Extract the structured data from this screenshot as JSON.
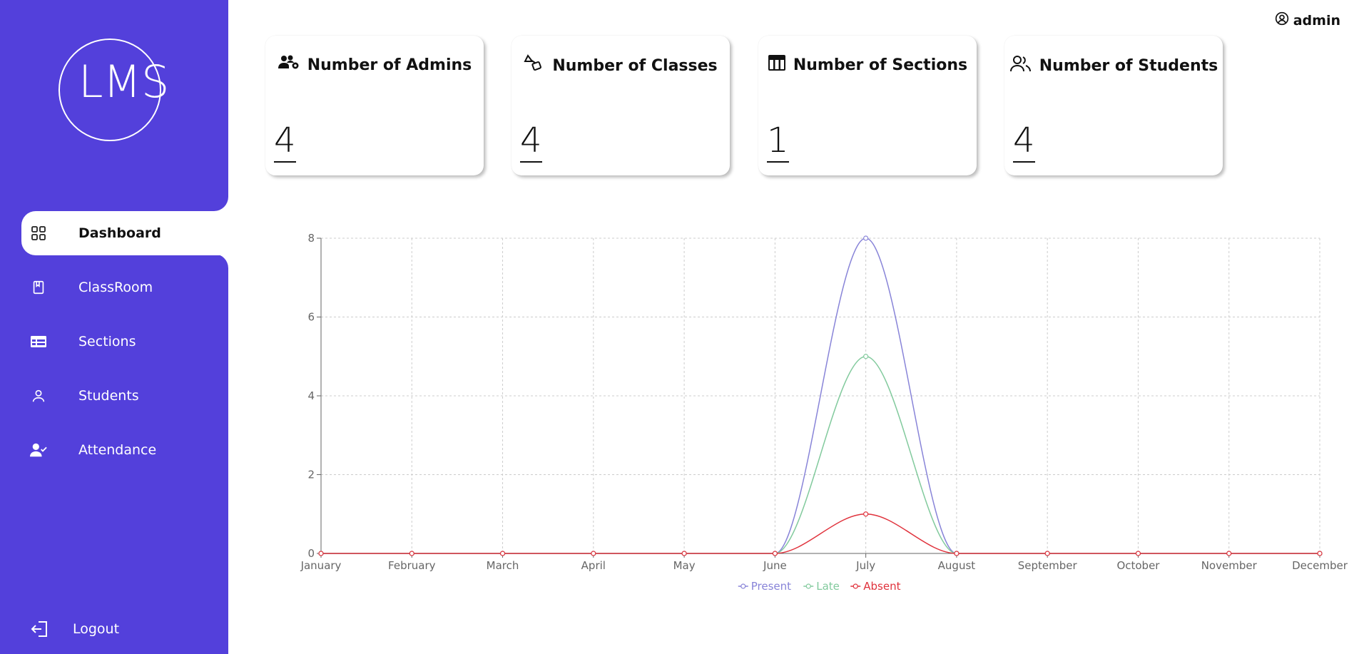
{
  "app": {
    "logo_text": "LMS"
  },
  "user": {
    "name": "admin",
    "icon": "user-circle-icon"
  },
  "sidebar": {
    "items": [
      {
        "label": "Dashboard",
        "icon": "grid-icon",
        "active": true
      },
      {
        "label": "ClassRoom",
        "icon": "book-icon",
        "active": false
      },
      {
        "label": "Sections",
        "icon": "table-icon",
        "active": false
      },
      {
        "label": "Students",
        "icon": "user-icon",
        "active": false
      },
      {
        "label": "Attendance",
        "icon": "user-check-icon",
        "active": false
      }
    ],
    "logout": {
      "label": "Logout",
      "icon": "logout-icon"
    }
  },
  "stats": [
    {
      "title": "Number of Admins",
      "value": "4",
      "icon": "users-gear-icon"
    },
    {
      "title": "Number of Classes",
      "value": "4",
      "icon": "shapes-icon"
    },
    {
      "title": "Number of Sections",
      "value": "1",
      "icon": "table-columns-icon"
    },
    {
      "title": "Number of Students",
      "value": "4",
      "icon": "users-icon"
    }
  ],
  "colors": {
    "sidebar": "#5340db",
    "present": "#8884d8",
    "late": "#82ca9d",
    "absent": "#e0323c"
  },
  "chart_data": {
    "type": "line",
    "categories": [
      "January",
      "February",
      "March",
      "April",
      "May",
      "June",
      "July",
      "August",
      "September",
      "October",
      "November",
      "December"
    ],
    "series": [
      {
        "name": "Present",
        "values": [
          0,
          0,
          0,
          0,
          0,
          0,
          8,
          0,
          0,
          0,
          0,
          0
        ]
      },
      {
        "name": "Late",
        "values": [
          0,
          0,
          0,
          0,
          0,
          0,
          5,
          0,
          0,
          0,
          0,
          0
        ]
      },
      {
        "name": "Absent",
        "values": [
          0,
          0,
          0,
          0,
          0,
          0,
          1,
          0,
          0,
          0,
          0,
          0
        ]
      }
    ],
    "yticks": [
      "0",
      "2",
      "4",
      "6",
      "8"
    ],
    "ylim": [
      0,
      8
    ],
    "grid": true,
    "legend": "bottom-center",
    "curve": "monotone"
  }
}
